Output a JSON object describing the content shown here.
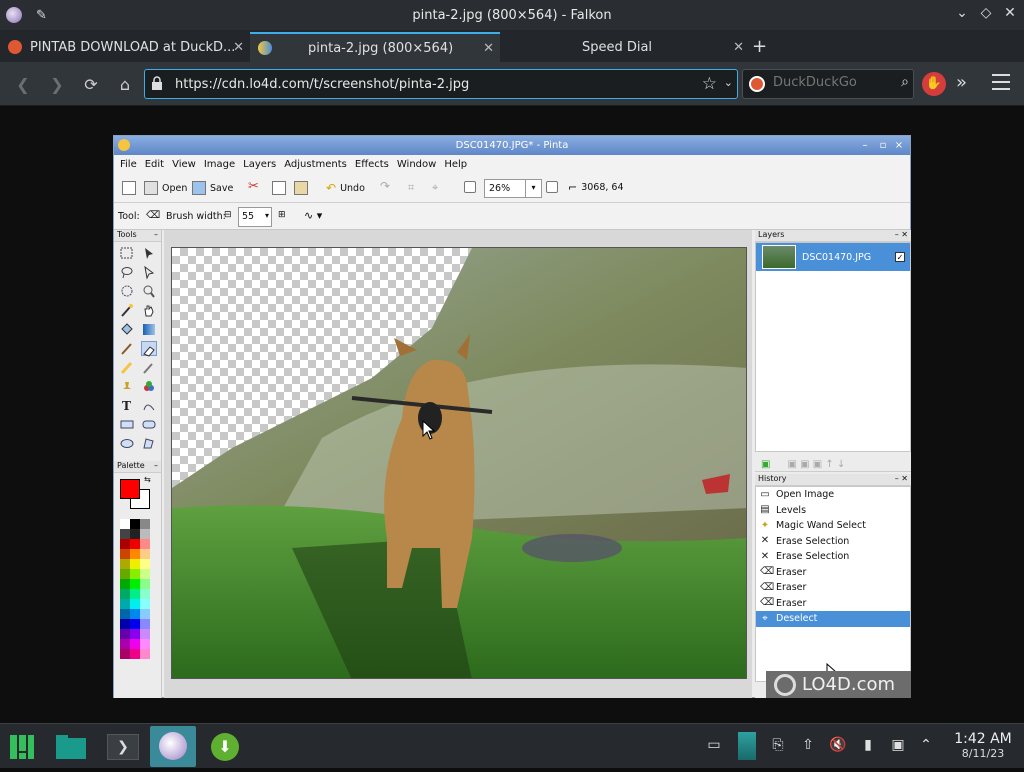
{
  "window": {
    "title": "pinta-2.jpg (800×564) - Falkon"
  },
  "tabs": [
    {
      "label": "PINTAB DOWNLOAD at DuckD...",
      "active": false
    },
    {
      "label": "pinta-2.jpg (800×564)",
      "active": true
    },
    {
      "label": "Speed Dial",
      "active": false
    }
  ],
  "navbar": {
    "url": "https://cdn.lo4d.com/t/screenshot/pinta-2.jpg",
    "search_placeholder": "DuckDuckGo"
  },
  "pinta": {
    "title": "DSC01470.JPG* - Pinta",
    "menu": [
      "File",
      "Edit",
      "View",
      "Image",
      "Layers",
      "Adjustments",
      "Effects",
      "Window",
      "Help"
    ],
    "toolbar": {
      "open_label": "Open",
      "save_label": "Save",
      "undo_label": "Undo",
      "zoom": "26%",
      "cursor_pos": "3068, 64"
    },
    "toolbar2": {
      "tool_label": "Tool:",
      "brush_width_label": "Brush width:",
      "brush_width_value": "55"
    },
    "tools_panel_label": "Tools",
    "palette_label": "Palette",
    "primary_color": "#ff0000",
    "secondary_color": "#ffffff",
    "layers_panel_label": "Layers",
    "layers": [
      {
        "name": "DSC01470.JPG",
        "visible": true
      }
    ],
    "history_panel_label": "History",
    "history": [
      {
        "label": "Open Image",
        "icon": "open-image-icon"
      },
      {
        "label": "Levels",
        "icon": "levels-icon"
      },
      {
        "label": "Magic Wand Select",
        "icon": "magic-wand-icon"
      },
      {
        "label": "Erase Selection",
        "icon": "erase-selection-icon"
      },
      {
        "label": "Erase Selection",
        "icon": "erase-selection-icon"
      },
      {
        "label": "Eraser",
        "icon": "eraser-icon"
      },
      {
        "label": "Eraser",
        "icon": "eraser-icon"
      },
      {
        "label": "Eraser",
        "icon": "eraser-icon"
      },
      {
        "label": "Deselect",
        "icon": "deselect-icon",
        "selected": true
      }
    ],
    "watermark": "LO4D.com"
  },
  "taskbar": {
    "time": "1:42 AM",
    "date": "8/11/23"
  },
  "colors": {
    "accent": "#3daee9",
    "selection": "#4a90d9"
  }
}
